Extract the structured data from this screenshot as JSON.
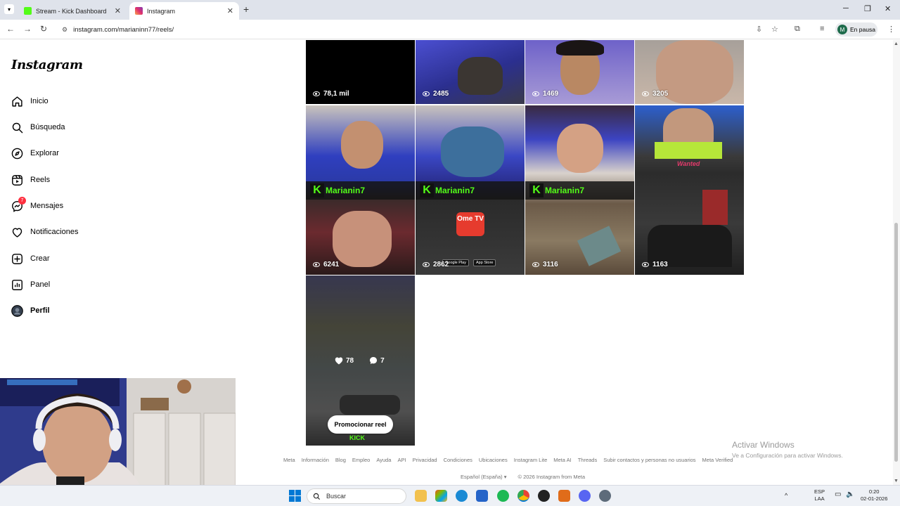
{
  "browser": {
    "tabs": [
      {
        "title": "Stream - Kick Dashboard",
        "icon": "kick-icon",
        "active": false
      },
      {
        "title": "Instagram",
        "icon": "instagram-icon",
        "active": true
      }
    ],
    "url": "instagram.com/marianinn77/reels/",
    "profile": {
      "initial": "M",
      "status": "En pausa"
    }
  },
  "instagram": {
    "logo": "Instagram",
    "nav": [
      {
        "label": "Inicio",
        "icon": "home-icon"
      },
      {
        "label": "Búsqueda",
        "icon": "search-icon"
      },
      {
        "label": "Explorar",
        "icon": "compass-icon"
      },
      {
        "label": "Reels",
        "icon": "reels-icon"
      },
      {
        "label": "Mensajes",
        "icon": "messenger-icon",
        "badge": "7"
      },
      {
        "label": "Notificaciones",
        "icon": "heart-icon"
      },
      {
        "label": "Crear",
        "icon": "plus-square-icon"
      },
      {
        "label": "Panel",
        "icon": "chart-icon"
      },
      {
        "label": "Perfil",
        "icon": "avatar-icon"
      }
    ],
    "reels": [
      {
        "views": "78,1 mil"
      },
      {
        "views": "2485"
      },
      {
        "views": "1469"
      },
      {
        "views": "3205"
      },
      {
        "views": "6241",
        "banner": "Marianin7"
      },
      {
        "views": "2862",
        "banner": "Marianin7",
        "brand": "Ome TV",
        "stores": [
          "Google Play",
          "App Store"
        ]
      },
      {
        "views": "3116",
        "banner": "Marianin7"
      },
      {
        "views": "1163",
        "sign": "Wanted"
      },
      {
        "likes": "78",
        "comments": "7",
        "action": "Promocionar reel",
        "overlay_text": "KICK"
      }
    ],
    "footer": {
      "links": [
        "Meta",
        "Información",
        "Blog",
        "Empleo",
        "Ayuda",
        "API",
        "Privacidad",
        "Condiciones",
        "Ubicaciones",
        "Instagram Lite",
        "Meta AI",
        "Threads",
        "Subir contactos y personas no usuarios",
        "Meta Verified"
      ],
      "language": "Español (España)",
      "copyright": "© 2026 Instagram from Meta"
    }
  },
  "windows": {
    "activate_title": "Activar Windows",
    "activate_sub": "Ve a Configuración para activar Windows.",
    "search_placeholder": "Buscar",
    "lang_1": "ESP",
    "lang_2": "LAA",
    "time": "0:20",
    "date": "02-01-2026"
  },
  "colors": {
    "kick_green": "#53fc18",
    "ig_badge": "#ff3040",
    "windows_blue": "#0078d4"
  }
}
